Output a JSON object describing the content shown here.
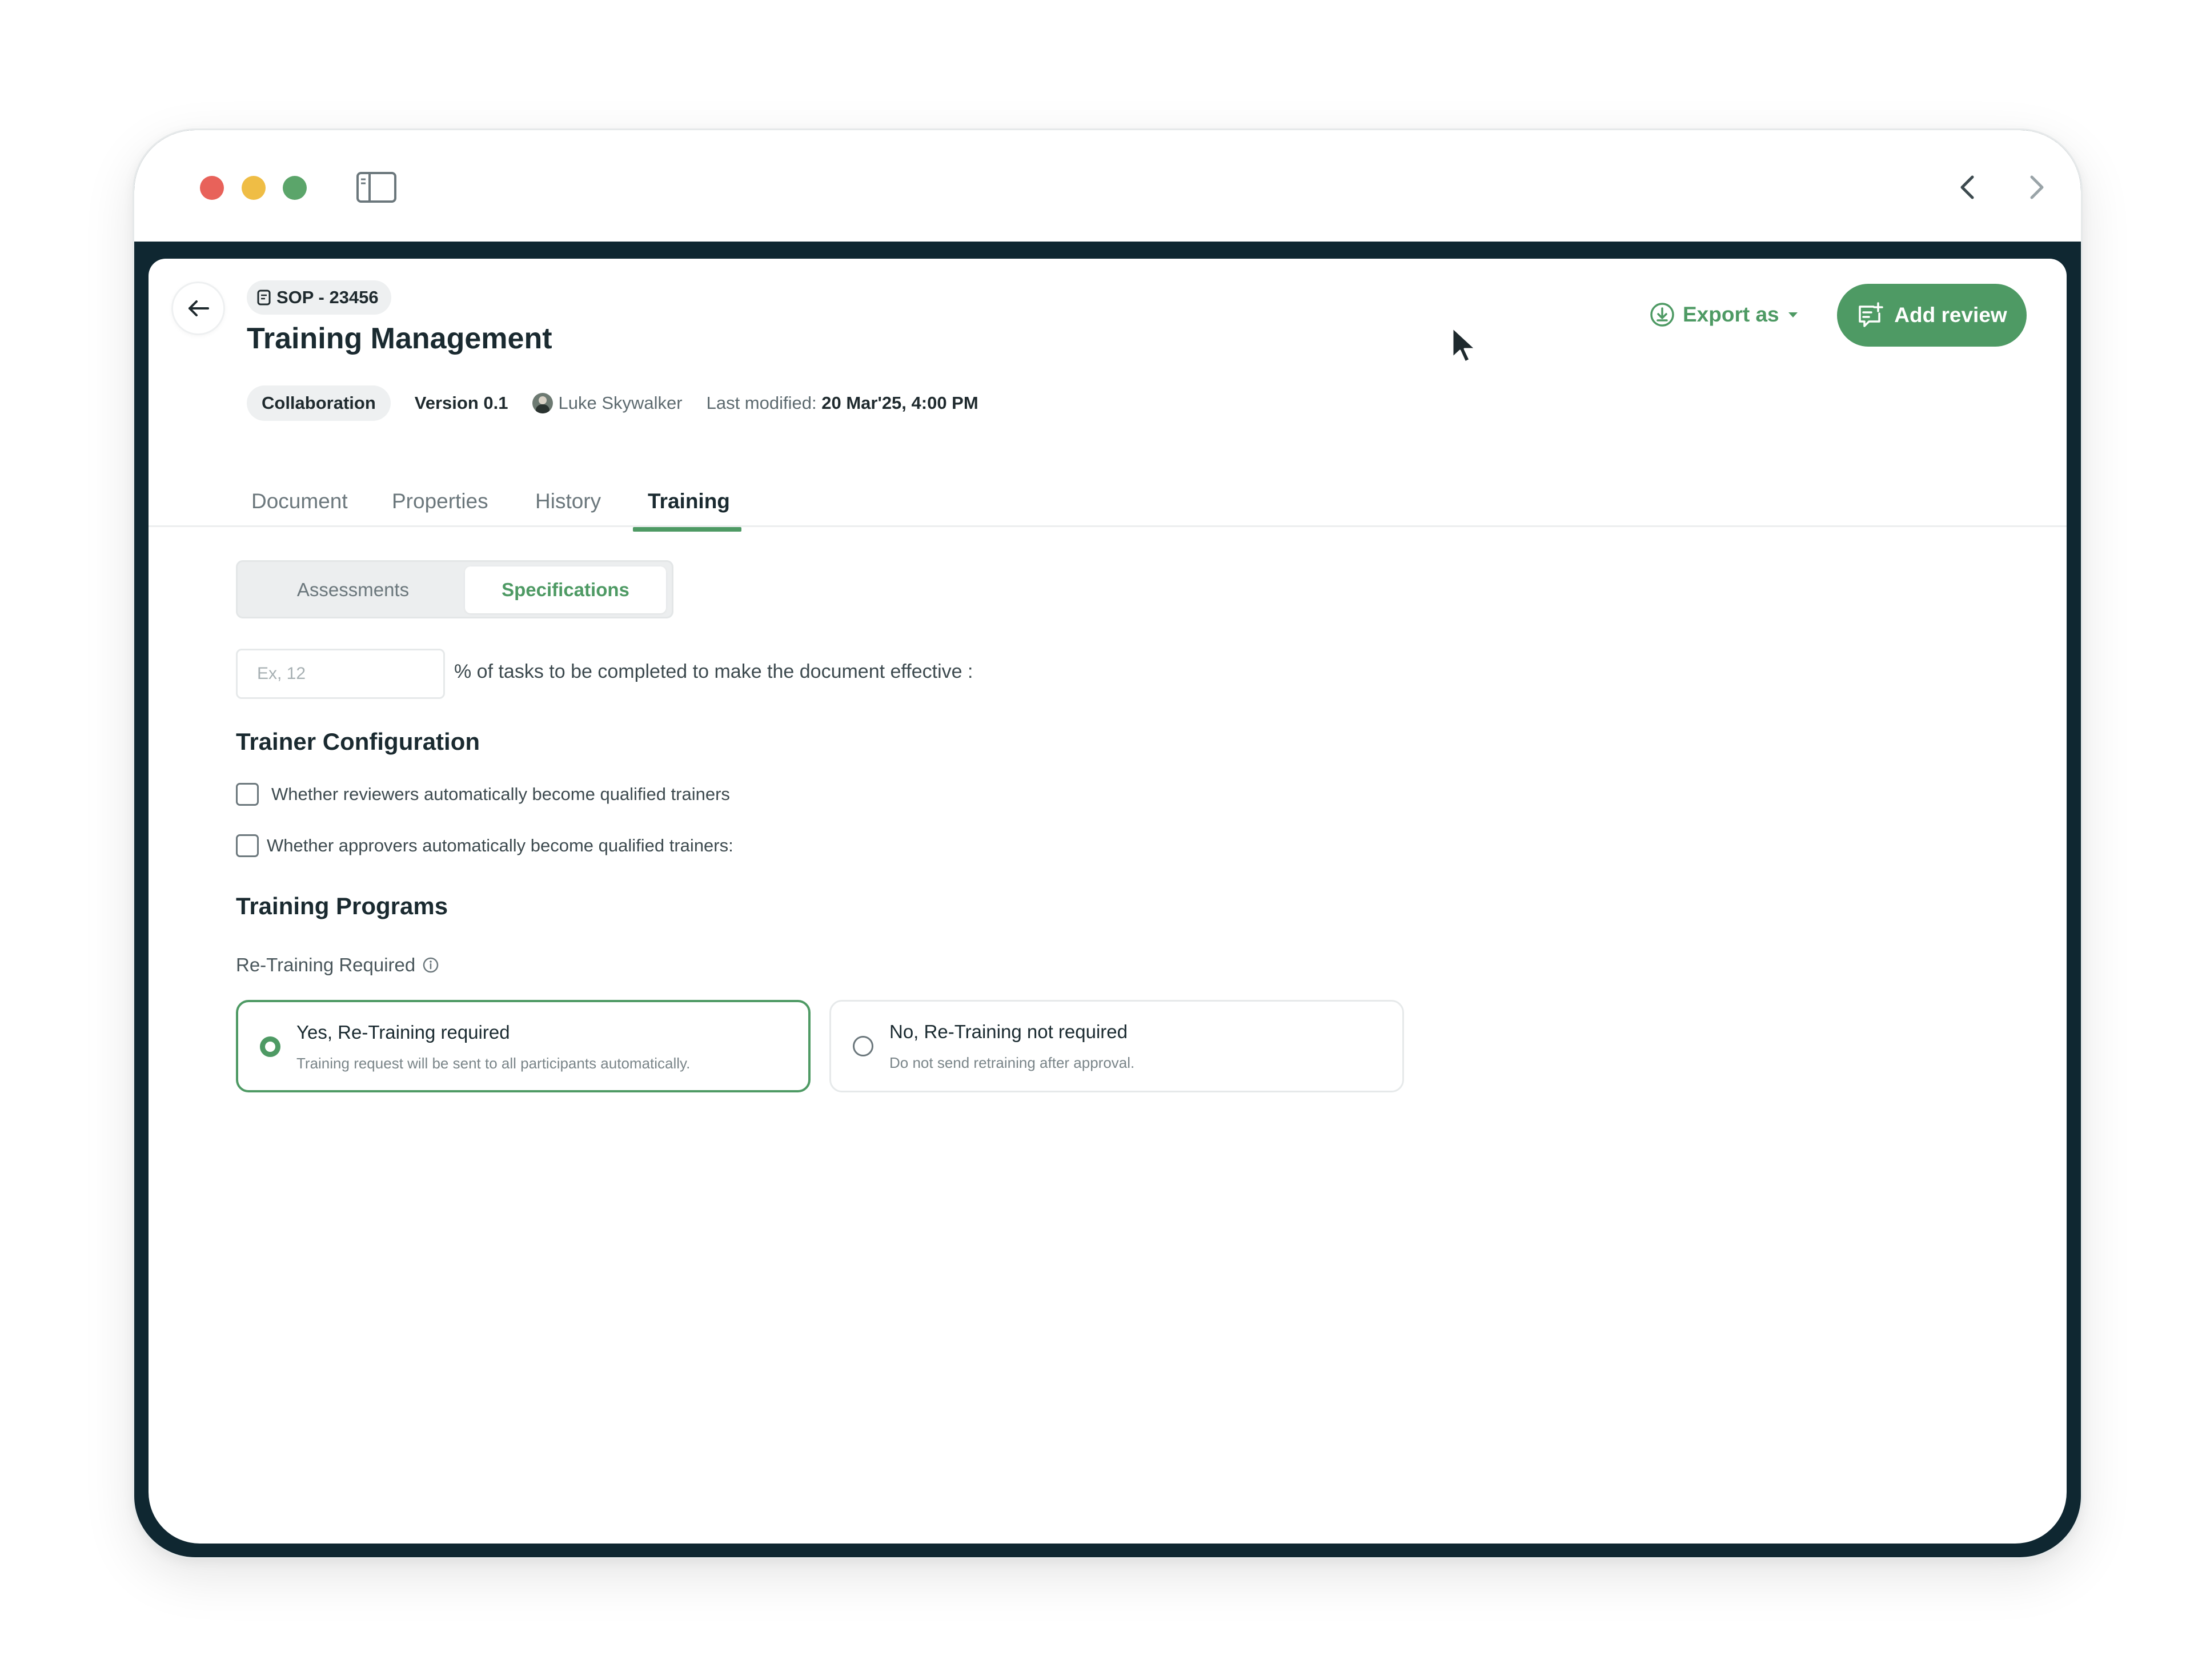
{
  "document": {
    "id": "SOP - 23456",
    "title": "Training Management",
    "status": "Collaboration",
    "version": "Version 0.1",
    "author": "Luke Skywalker",
    "last_modified_label": "Last modified:",
    "last_modified_value": "20 Mar'25, 4:00 PM"
  },
  "actions": {
    "export_label": "Export as",
    "add_review_label": "Add review"
  },
  "tabs": [
    {
      "label": "Document",
      "active": false
    },
    {
      "label": "Properties",
      "active": false
    },
    {
      "label": "History",
      "active": false
    },
    {
      "label": "Training",
      "active": true
    }
  ],
  "segmented": {
    "assessments": "Assessments",
    "specifications": "Specifications",
    "selected": "Specifications"
  },
  "completion": {
    "placeholder": "Ex, 12",
    "label": "% of tasks to be completed to make the document effective :"
  },
  "trainer_config": {
    "title": "Trainer Configuration",
    "options": [
      {
        "label": "Whether reviewers automatically become qualified trainers",
        "checked": false
      },
      {
        "label": "Whether approvers automatically become qualified trainers:",
        "checked": false
      }
    ]
  },
  "training_programs": {
    "title": "Training Programs",
    "retraining_label": "Re-Training Required",
    "options": [
      {
        "title": "Yes, Re-Training required",
        "description": "Training request will be sent to all participants automatically.",
        "selected": true
      },
      {
        "title": "No, Re-Training not required",
        "description": "Do not send retraining after approval.",
        "selected": false
      }
    ]
  },
  "colors": {
    "accent": "#4e9a64",
    "frame": "#0f2731",
    "traffic_red": "#e8625a",
    "traffic_yellow": "#efbd45",
    "traffic_green": "#5ba56a"
  },
  "icons": {
    "back": "arrow-left-icon",
    "badge": "document-icon",
    "export": "download-circle-icon",
    "add_review": "comment-plus-icon",
    "info": "info-icon"
  }
}
